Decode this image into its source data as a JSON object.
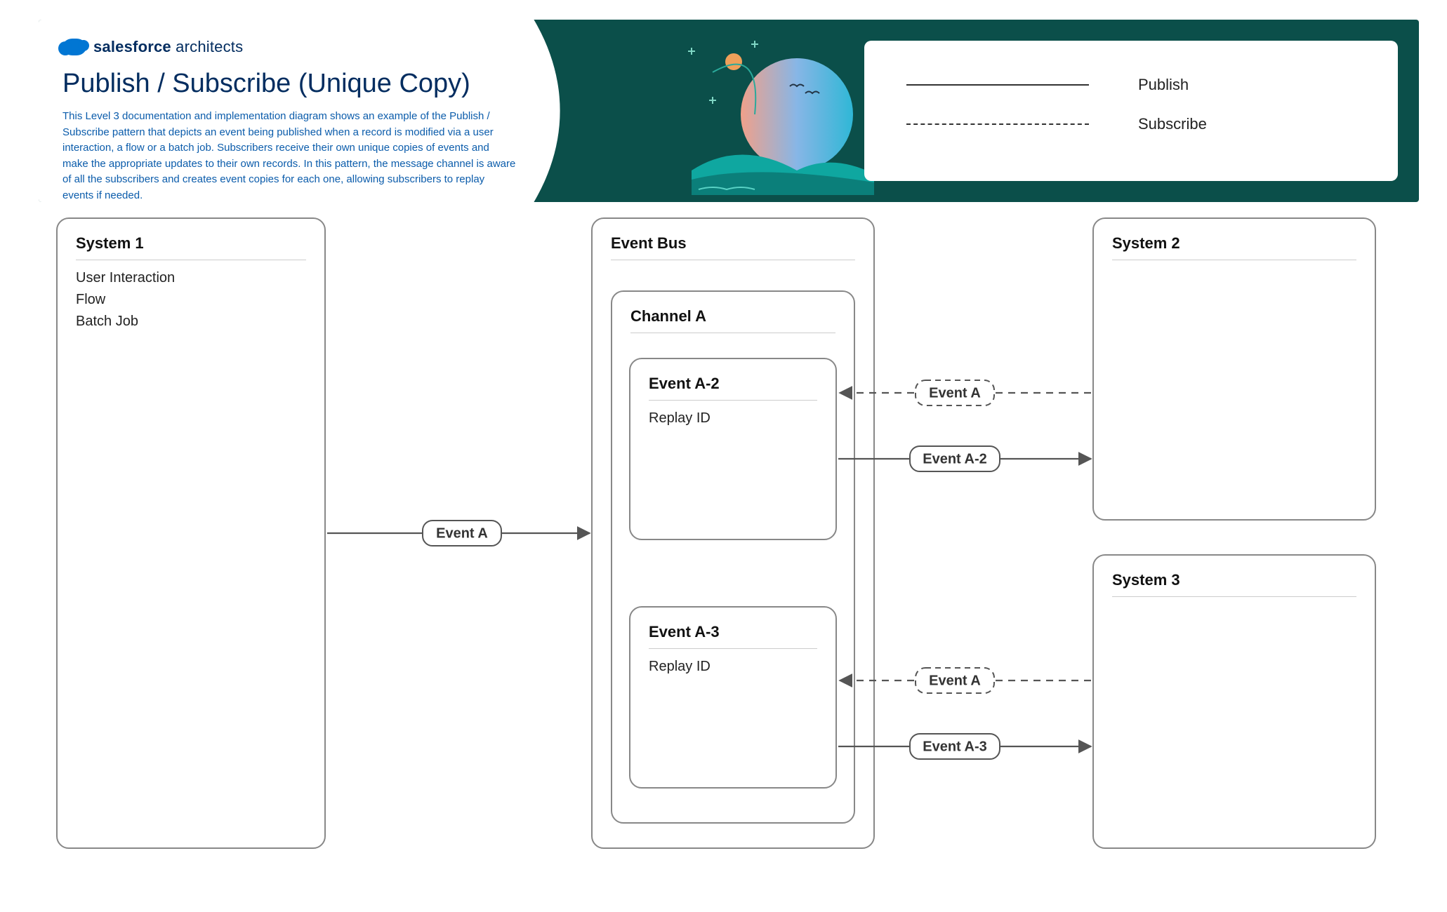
{
  "brand": {
    "bold": "salesforce",
    "light": "architects"
  },
  "doc": {
    "title": "Publish / Subscribe (Unique Copy)",
    "description": "This Level 3 documentation and implementation diagram shows an example of the Publish / Subscribe pattern that depicts an event being published when a record is modified via a user interaction, a flow or a batch job. Subscribers receive their own unique copies of events and make the appropriate updates to their own records.  In this pattern, the message channel is aware of all the subscribers and creates event copies for each one, allowing subscribers to replay events if needed."
  },
  "legend": {
    "publish": "Publish",
    "subscribe": "Subscribe"
  },
  "boxes": {
    "system1": {
      "title": "System 1",
      "items": [
        "User Interaction",
        "Flow",
        "Batch Job"
      ]
    },
    "eventbus": {
      "title": "Event Bus"
    },
    "channelA": {
      "title": "Channel A"
    },
    "eventA2": {
      "title": "Event A-2",
      "body": "Replay ID"
    },
    "eventA3": {
      "title": "Event A-3",
      "body": "Replay ID"
    },
    "system2": {
      "title": "System 2"
    },
    "system3": {
      "title": "System 3"
    }
  },
  "arrows": {
    "sys1_to_channel": {
      "label": "Event A",
      "style": "solid"
    },
    "sys2_subscribe_channel": {
      "label": "Event A",
      "style": "dashed"
    },
    "channel_deliver_sys2": {
      "label": "Event A-2",
      "style": "solid"
    },
    "sys3_subscribe_channel": {
      "label": "Event A",
      "style": "dashed"
    },
    "channel_deliver_sys3": {
      "label": "Event A-3",
      "style": "solid"
    }
  }
}
